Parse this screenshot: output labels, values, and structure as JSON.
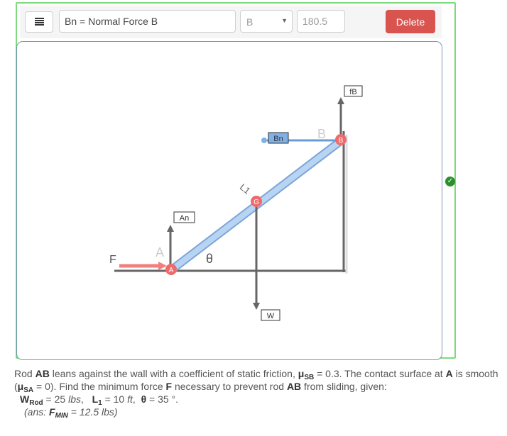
{
  "toolbar": {
    "menu_icon": "hamburger-icon",
    "force_name_value": "Bn = Normal Force B",
    "point_select_value": "B",
    "angle_value": "180.5",
    "delete_label": "Delete"
  },
  "diagram": {
    "point_labels": {
      "A": "A",
      "B": "B",
      "G": "G"
    },
    "force_labels": {
      "fB": "fB",
      "Bn": "Bn",
      "An": "An",
      "W": "W",
      "F": "F"
    },
    "length_label": "L1",
    "angle_label": "θ",
    "colors": {
      "rod": "#a9c9ef",
      "rod_edge": "#7aa6d8",
      "point": "#ef6a6a",
      "push_arrow": "#f08080",
      "force_arrow": "#666666",
      "selected_force": "#7fb0e6",
      "frame_green": "#7ed97e",
      "delete_red": "#d9534f",
      "check_green": "#2b8f2b"
    }
  },
  "status": {
    "icon": "check-icon"
  },
  "problem": {
    "line1_a": "Rod ",
    "rod_name": "AB",
    "line1_b": " leans against the wall with a coefficient of static friction, ",
    "mu": "μ",
    "mu_sb_sub": "SB",
    "mu_sb_val": " = 0.3. The contact surface at ",
    "point_a": "A",
    "line1_c": " is smooth",
    "line2_a": "(",
    "mu_sa_sub": "SA",
    "line2_b": " = 0). Find the minimum force ",
    "force_f": "F",
    "line2_c": " necessary to prevent rod ",
    "rod_name2": "AB",
    "line2_d": " from sliding, given:",
    "w_label": "W",
    "w_sub": "Rod",
    "w_val": " = 25 ",
    "w_unit": "lbs",
    "l_label": "L",
    "l_sub": "1",
    "l_val": " = 10 ",
    "l_unit": "ft",
    "theta_label": "θ",
    "theta_val": " = 35 °.",
    "ans_prefix": "(ans: ",
    "ans_label": "F",
    "ans_sub": "MIN",
    "ans_val": " = 12.5 ",
    "ans_unit": "lbs",
    "ans_suffix": ")"
  }
}
